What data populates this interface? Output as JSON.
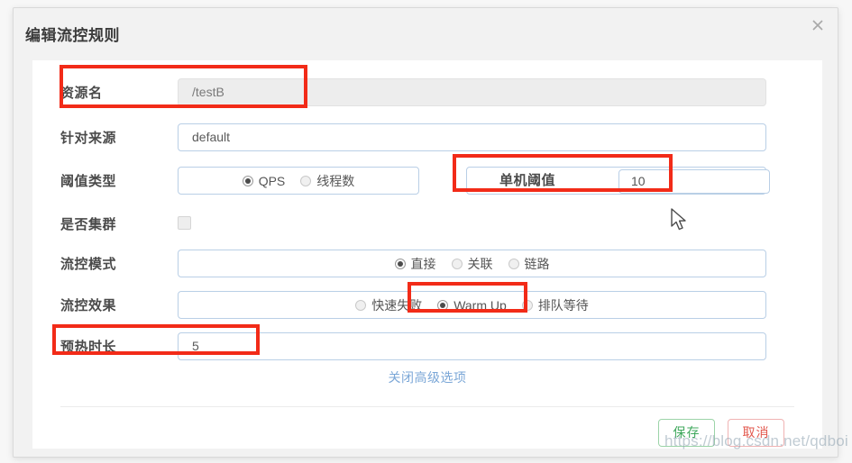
{
  "dialog": {
    "title": "编辑流控规则",
    "close_icon": "close-icon"
  },
  "form": {
    "resource": {
      "label": "资源名",
      "value": "/testB",
      "disabled": true
    },
    "origin": {
      "label": "针对来源",
      "value": "default",
      "placeholder": "default"
    },
    "threshold_type": {
      "label": "阈值类型",
      "options": [
        {
          "label": "QPS",
          "checked": true
        },
        {
          "label": "线程数",
          "checked": false
        }
      ],
      "single_threshold": {
        "label": "单机阈值",
        "value": "10"
      }
    },
    "cluster": {
      "label": "是否集群",
      "checked": false
    },
    "flow_mode": {
      "label": "流控模式",
      "options": [
        {
          "label": "直接",
          "checked": true
        },
        {
          "label": "关联",
          "checked": false
        },
        {
          "label": "链路",
          "checked": false
        }
      ]
    },
    "flow_effect": {
      "label": "流控效果",
      "options": [
        {
          "label": "快速失败",
          "checked": false
        },
        {
          "label": "Warm Up",
          "checked": true
        },
        {
          "label": "排队等待",
          "checked": false
        }
      ]
    },
    "warmup_duration": {
      "label": "预热时长",
      "value": "5"
    }
  },
  "advanced_link": "关闭高级选项",
  "footer": {
    "save_label": "保存",
    "cancel_label": "取消"
  },
  "watermark": "https://blog.csdn.net/qdboi",
  "colors": {
    "annotation": "#f22b18",
    "link": "#7ba7d7",
    "save": "#3fa85c",
    "cancel": "#e2574c"
  }
}
